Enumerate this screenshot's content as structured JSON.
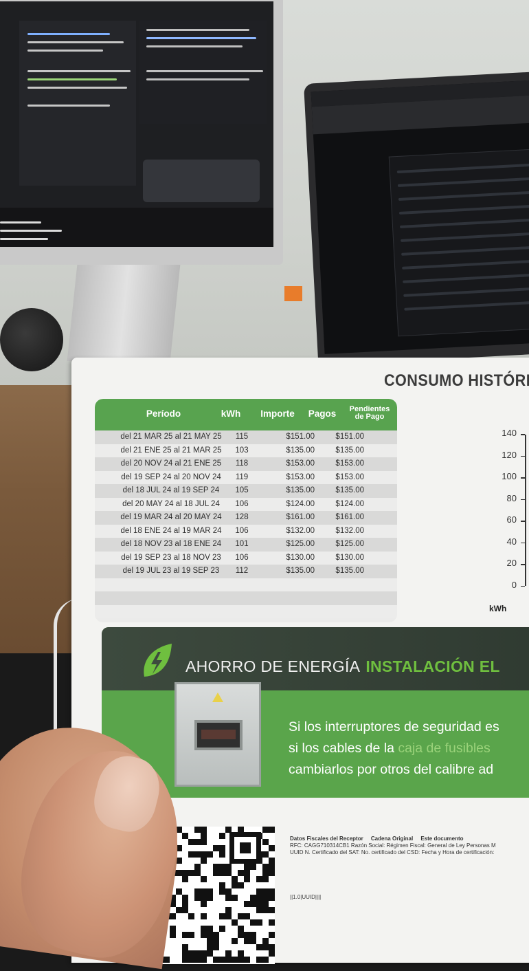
{
  "paper": {
    "section_title": "CONSUMO HISTÓRI",
    "table": {
      "headers": {
        "period": "Período",
        "kwh": "kWh",
        "amount": "Importe",
        "payments": "Pagos",
        "pending_line1": "Pendientes",
        "pending_line2": "de Pago"
      },
      "rows": [
        {
          "period": "del 21 MAR 25 al 21 MAY 25",
          "kwh": "115",
          "amount": "$151.00",
          "payment": "$151.00"
        },
        {
          "period": "del 21 ENE 25 al 21 MAR 25",
          "kwh": "103",
          "amount": "$135.00",
          "payment": "$135.00"
        },
        {
          "period": "del 20 NOV 24 al 21 ENE 25",
          "kwh": "118",
          "amount": "$153.00",
          "payment": "$153.00"
        },
        {
          "period": "del 19 SEP 24 al 20 NOV 24",
          "kwh": "119",
          "amount": "$153.00",
          "payment": "$153.00"
        },
        {
          "period": "del 18 JUL 24 al 19 SEP 24",
          "kwh": "105",
          "amount": "$135.00",
          "payment": "$135.00"
        },
        {
          "period": "del 20 MAY 24 al 18 JUL 24",
          "kwh": "106",
          "amount": "$124.00",
          "payment": "$124.00"
        },
        {
          "period": "del 19 MAR 24 al 20 MAY 24",
          "kwh": "128",
          "amount": "$161.00",
          "payment": "$161.00"
        },
        {
          "period": "del 18 ENE 24 al 19 MAR 24",
          "kwh": "106",
          "amount": "$132.00",
          "payment": "$132.00"
        },
        {
          "period": "del 18 NOV 23 al 18 ENE 24",
          "kwh": "101",
          "amount": "$125.00",
          "payment": "$125.00"
        },
        {
          "period": "del 19 SEP 23 al 18 NOV 23",
          "kwh": "106",
          "amount": "$130.00",
          "payment": "$130.00"
        },
        {
          "period": "del 19 JUL 23 al 19 SEP 23",
          "kwh": "112",
          "amount": "$135.00",
          "payment": "$135.00"
        }
      ]
    },
    "chart": {
      "y_ticks": [
        "140",
        "120",
        "100",
        "80",
        "60",
        "40",
        "20",
        "0"
      ],
      "y_label": "kWh"
    },
    "banner": {
      "title": "AHORRO DE ENERGÍA",
      "title_accent": "INSTALACIÓN EL",
      "line1": "Si los interruptores de seguridad es",
      "line2_before": "si los cables de la ",
      "line2_highlight": "caja de fusibles",
      "line3": "cambiarlos por otros del calibre ad"
    },
    "fiscal": {
      "heading1": "Datos Fiscales del Receptor",
      "heading2": "Cadena Original",
      "heading3": "Este documento",
      "line1": "RFC: CAGG710314CB1  Razón Social:  Régimen Fiscal: General de Ley Personas M",
      "line2": "UUID N. Certificado del SAT:  No. certificado del CSD:  Fecha y Hora de certificación:",
      "code": "||1.0|UUID||||"
    }
  },
  "colors": {
    "table_header_green": "#58a34f",
    "banner_green": "#5aa54b",
    "banner_dark": "#3d4a3e",
    "accent_green": "#6fbf3f"
  }
}
